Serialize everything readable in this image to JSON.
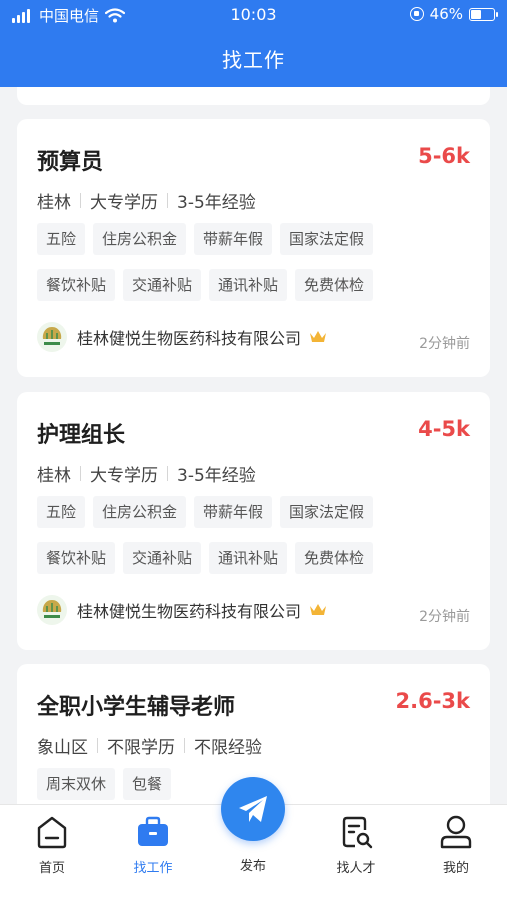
{
  "status": {
    "carrier": "中国电信",
    "time": "10:03",
    "battery_text": "46%",
    "battery_level": 0.46
  },
  "nav": {
    "title": "找工作"
  },
  "jobs": [
    {
      "title": "预算员",
      "salary": "5-6k",
      "meta": [
        "桂林",
        "大专学历",
        "3-5年经验"
      ],
      "tags": [
        "五险",
        "住房公积金",
        "带薪年假",
        "国家法定假",
        "餐饮补贴",
        "交通补贴",
        "通讯补贴",
        "免费体检"
      ],
      "company": "桂林健悦生物医药科技有限公司",
      "time": "2分钟前"
    },
    {
      "title": "护理组长",
      "salary": "4-5k",
      "meta": [
        "桂林",
        "大专学历",
        "3-5年经验"
      ],
      "tags": [
        "五险",
        "住房公积金",
        "带薪年假",
        "国家法定假",
        "餐饮补贴",
        "交通补贴",
        "通讯补贴",
        "免费体检"
      ],
      "company": "桂林健悦生物医药科技有限公司",
      "time": "2分钟前"
    },
    {
      "title": "全职小学生辅导老师",
      "salary": "2.6-3k",
      "meta": [
        "象山区",
        "不限学历",
        "不限经验"
      ],
      "tags": [
        "周末双休",
        "包餐"
      ]
    }
  ],
  "tabbar": {
    "home": "首页",
    "jobs": "找工作",
    "publish": "发布",
    "talent": "找人才",
    "mine": "我的"
  },
  "colors": {
    "brand_blue": "#2f7bf0",
    "salary_red": "#ea4a4a"
  }
}
